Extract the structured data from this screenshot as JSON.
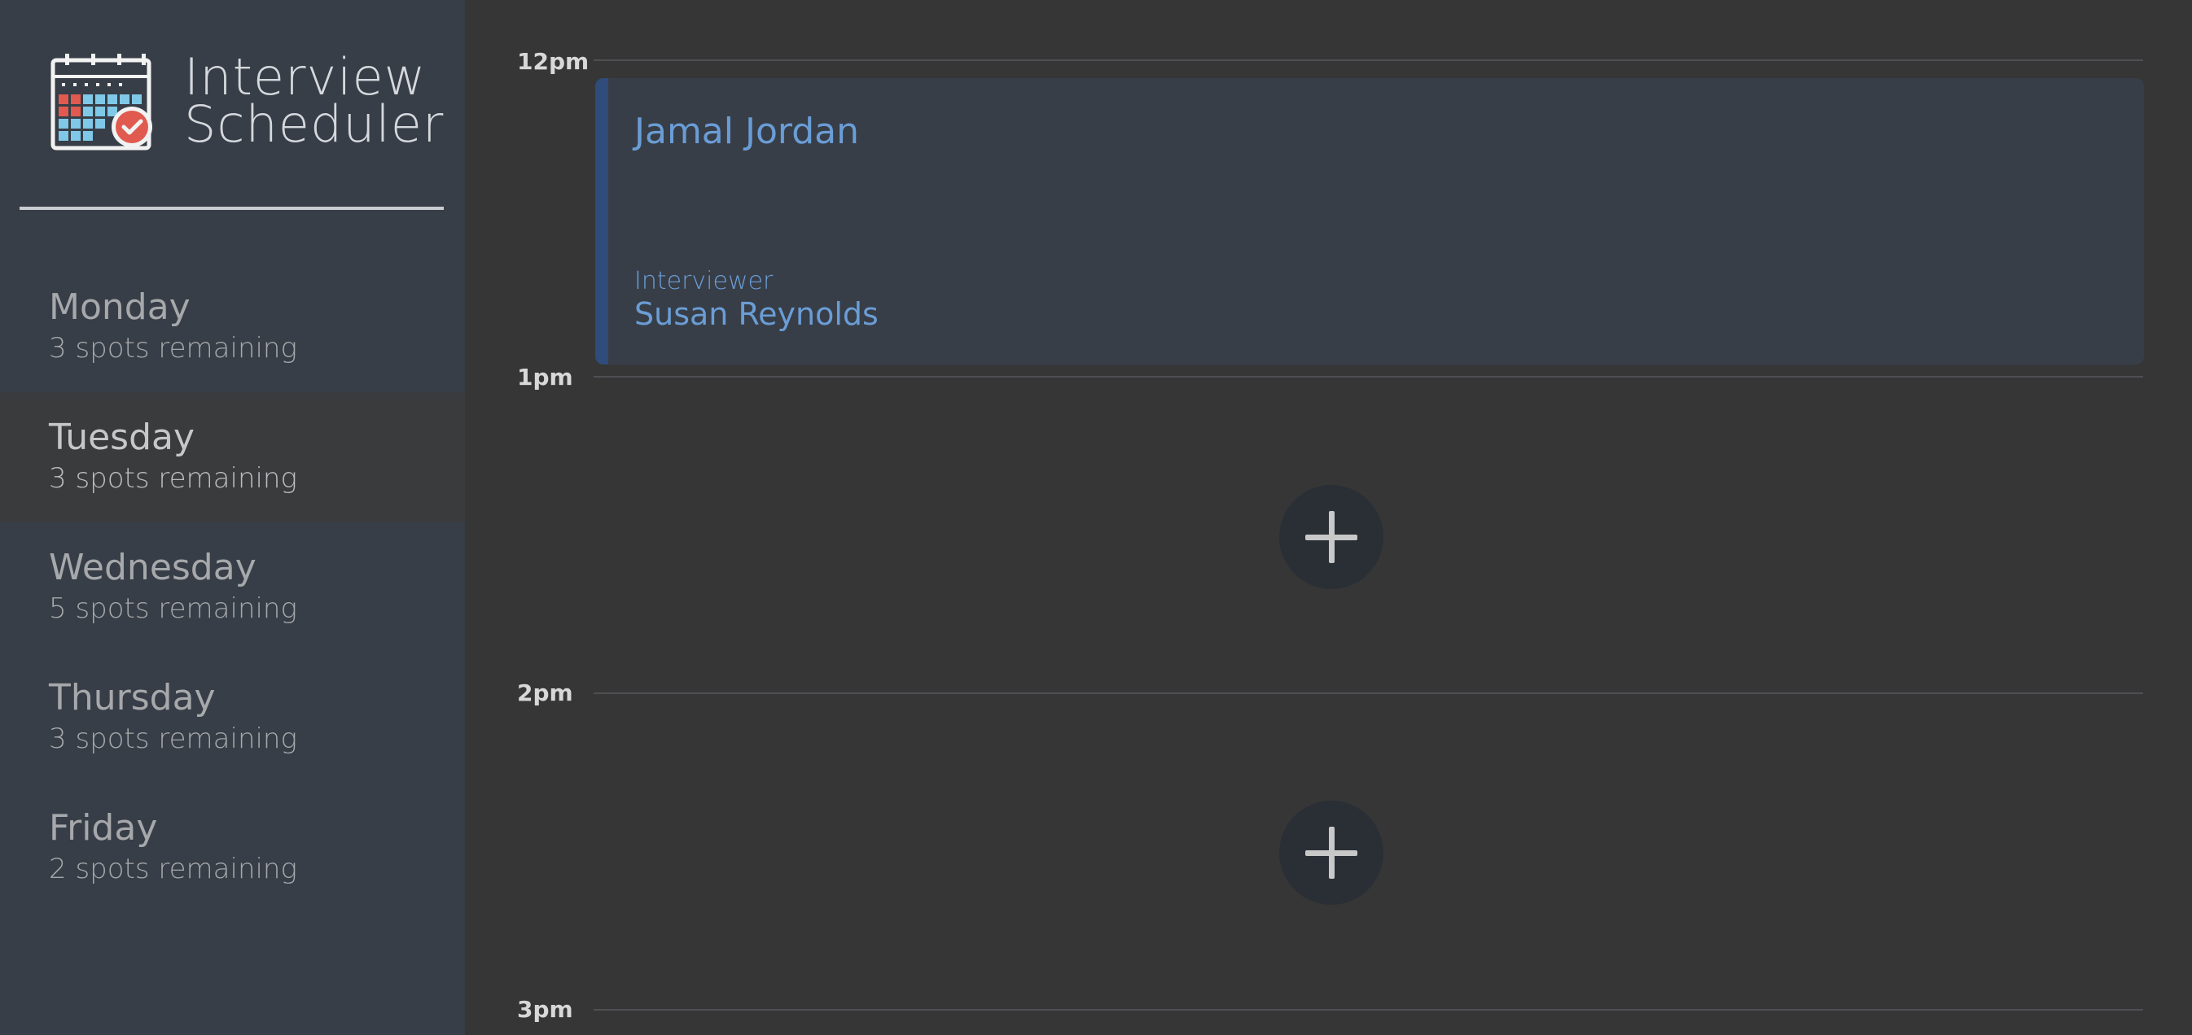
{
  "app": {
    "title_line1": "Interview",
    "title_line2": "Scheduler",
    "logo_icon": "calendar-check-icon"
  },
  "sidebar": {
    "days": [
      {
        "name": "Monday",
        "spots": "3 spots remaining",
        "selected": false
      },
      {
        "name": "Tuesday",
        "spots": "3 spots remaining",
        "selected": true
      },
      {
        "name": "Wednesday",
        "spots": "5 spots remaining",
        "selected": false
      },
      {
        "name": "Thursday",
        "spots": "3 spots remaining",
        "selected": false
      },
      {
        "name": "Friday",
        "spots": "2 spots remaining",
        "selected": false
      }
    ]
  },
  "schedule": {
    "times": [
      "12pm",
      "1pm",
      "2pm",
      "3pm"
    ],
    "appointment": {
      "student": "Jamal Jordan",
      "interviewer_label": "Interviewer",
      "interviewer": "Susan Reynolds"
    },
    "add_icon": "plus-icon"
  },
  "colors": {
    "background": "#363637",
    "sidebar": "#383e47",
    "selected_day": "#3a3b3d",
    "accent": "#6a9dd6",
    "card_accent_bar": "#2f4c7a",
    "logo_red": "#e05a4f",
    "logo_blue": "#7fc8e8"
  }
}
